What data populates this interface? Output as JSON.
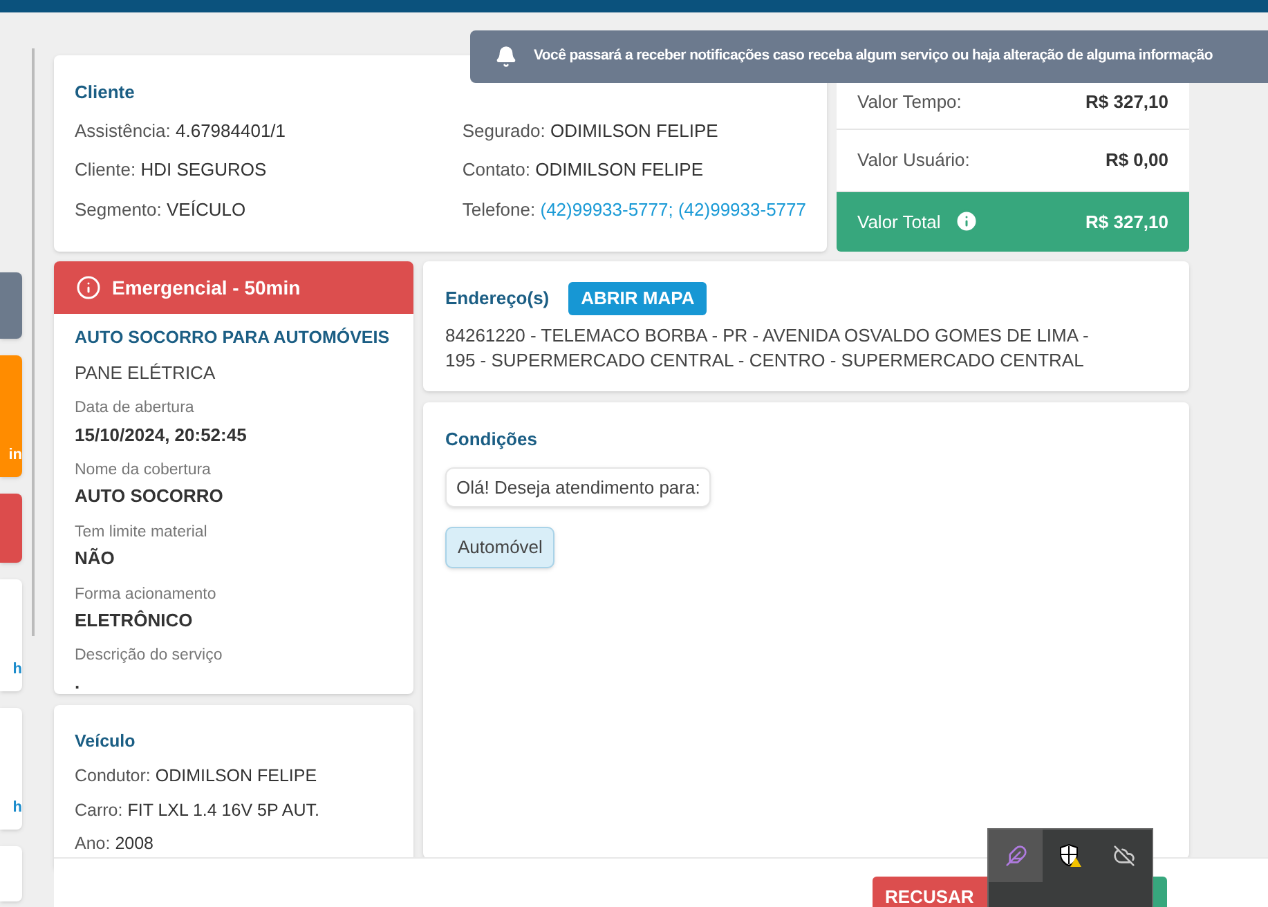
{
  "notification": {
    "text": "Você passará a receber notificações caso receba algum serviço ou haja alteração de alguma informação"
  },
  "side_cards": [
    {
      "kind": "grey"
    },
    {
      "kind": "orange",
      "text": "in"
    },
    {
      "kind": "red"
    },
    {
      "kind": "white",
      "text": "h"
    },
    {
      "kind": "white",
      "text": "h"
    },
    {
      "kind": "white"
    }
  ],
  "cliente": {
    "title": "Cliente",
    "left": [
      {
        "label": "Assistência:",
        "value": "4.67984401/1"
      },
      {
        "label": "Cliente:",
        "value": "HDI SEGUROS"
      },
      {
        "label": "Segmento:",
        "value": "VEÍCULO"
      }
    ],
    "right": [
      {
        "label": "Segurado:",
        "value": "ODIMILSON FELIPE",
        "kind": "text"
      },
      {
        "label": "Contato:",
        "value": "ODIMILSON FELIPE",
        "kind": "text"
      },
      {
        "label": "Telefone:",
        "value": "(42)99933-5777; (42)99933-5777",
        "kind": "link"
      }
    ]
  },
  "valores": [
    {
      "label": "Valor Tempo:",
      "value": "R$ 327,10",
      "total": false
    },
    {
      "label": "Valor Usuário:",
      "value": "R$ 0,00",
      "total": false
    },
    {
      "label": "Valor Total",
      "value": "R$ 327,10",
      "total": true
    }
  ],
  "servico": {
    "priority": "Emergencial - 50min",
    "title": "AUTO SOCORRO PARA AUTOMÓVEIS",
    "subtitle": "PANE ELÉTRICA",
    "fields": [
      {
        "label": "Data de abertura",
        "value": "15/10/2024, 20:52:45"
      },
      {
        "label": "Nome da cobertura",
        "value": "AUTO SOCORRO"
      },
      {
        "label": "Tem limite material",
        "value": "NÃO"
      },
      {
        "label": "Forma acionamento",
        "value": "ELETRÔNICO"
      },
      {
        "label": "Descrição do serviço",
        "value": "."
      }
    ]
  },
  "veiculo": {
    "title": "Veículo",
    "lines": [
      {
        "label": "Condutor:",
        "value": "ODIMILSON FELIPE"
      },
      {
        "label": "Carro:",
        "value": "FIT LXL 1.4 16V 5P AUT."
      },
      {
        "label": "Ano:",
        "value": "2008"
      }
    ]
  },
  "endereco": {
    "title": "Endereço(s)",
    "button": "ABRIR MAPA",
    "text": "84261220 - TELEMACO BORBA - PR - AVENIDA OSVALDO GOMES DE LIMA - 195 - SUPERMERCADO CENTRAL - CENTRO - SUPERMERCADO CENTRAL"
  },
  "condicoes": {
    "title": "Condições",
    "question": "Olá! Deseja atendimento para:",
    "answer": "Automóvel"
  },
  "footer": {
    "reject": "RECUSAR"
  }
}
